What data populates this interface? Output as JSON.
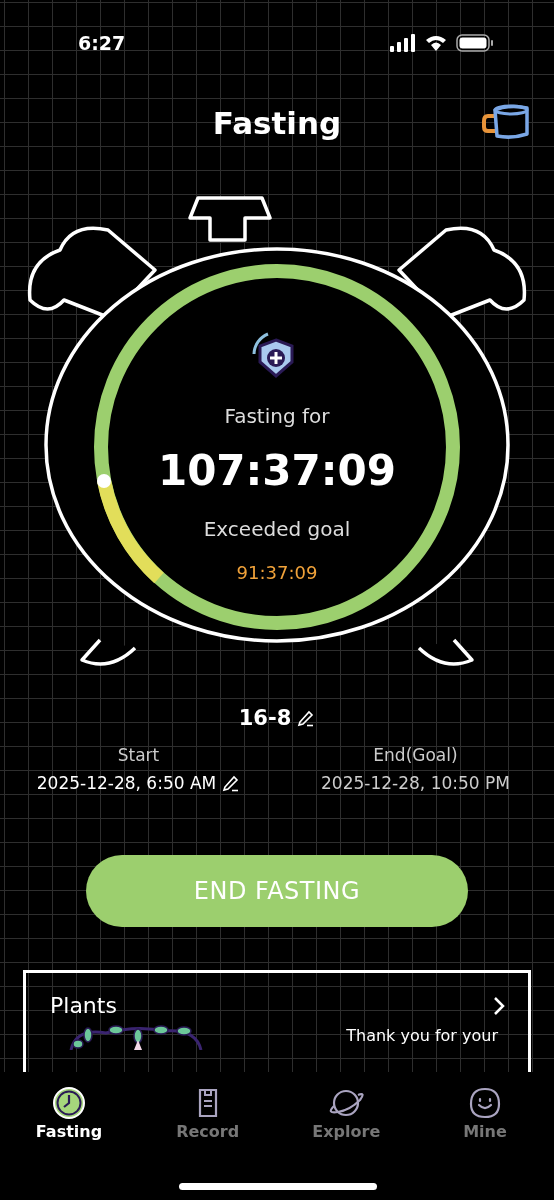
{
  "status_bar": {
    "time": "6:27"
  },
  "header": {
    "title": "Fasting"
  },
  "timer": {
    "label": "Fasting for",
    "elapsed": "107:37:09",
    "goal_label": "Exceeded goal",
    "exceeded": "91:37:09"
  },
  "plan": {
    "name": "16-8"
  },
  "start": {
    "label": "Start",
    "value": "2025-12-28, 6:50 AM"
  },
  "end": {
    "label": "End(Goal)",
    "value": "2025-12-28, 10:50 PM"
  },
  "end_button": {
    "label": "END FASTING"
  },
  "plants_card": {
    "title": "Plants",
    "message": "Thank you for your"
  },
  "tabs": [
    {
      "label": "Fasting",
      "kind": "clock",
      "selected": true
    },
    {
      "label": "Record",
      "kind": "record",
      "selected": false
    },
    {
      "label": "Explore",
      "kind": "explore",
      "selected": false
    },
    {
      "label": "Mine",
      "kind": "mine",
      "selected": false
    }
  ]
}
